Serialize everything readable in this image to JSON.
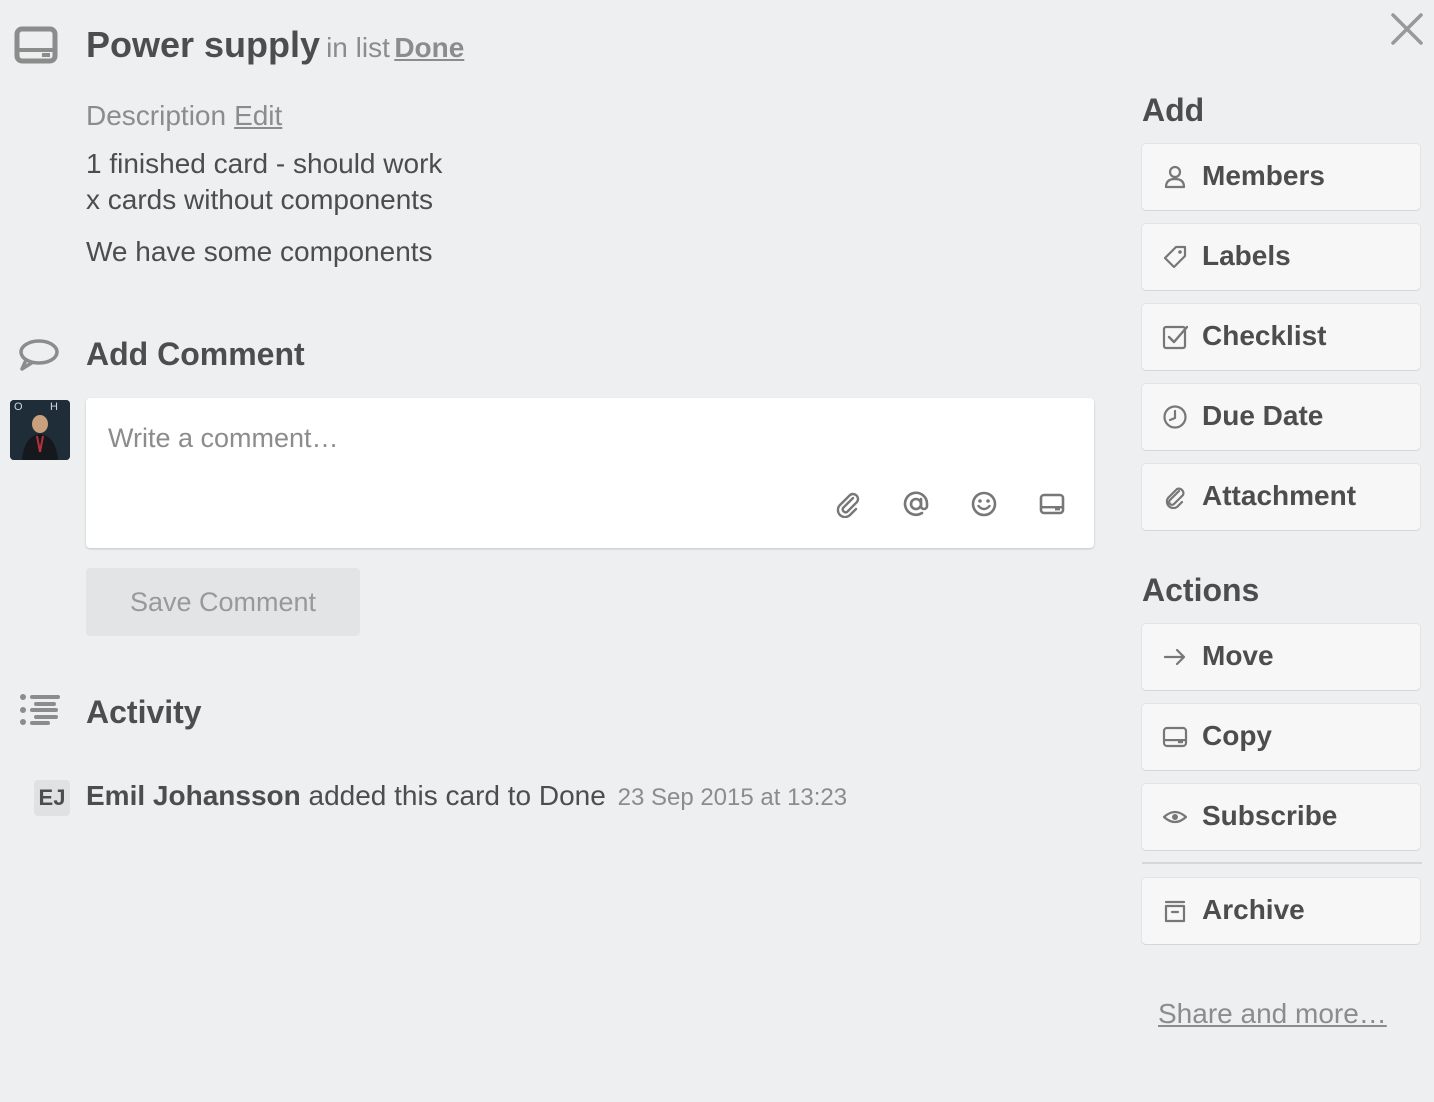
{
  "card": {
    "title": "Power supply",
    "in_list_text": "in list",
    "list_name": "Done"
  },
  "description": {
    "label": "Description",
    "edit_label": "Edit",
    "lines": [
      "1 finished card - should work",
      "x cards without components",
      "We have some components"
    ]
  },
  "comment": {
    "section_title": "Add Comment",
    "placeholder": "Write a comment…",
    "save_label": "Save Comment",
    "icons": [
      "paperclip-icon",
      "mention-icon",
      "emoji-icon",
      "card-icon"
    ]
  },
  "activity": {
    "section_title": "Activity",
    "entries": [
      {
        "initials": "EJ",
        "member": "Emil Johansson",
        "action": "added this card to Done",
        "date": "23 Sep 2015 at 13:23"
      }
    ]
  },
  "sidebar": {
    "add_title": "Add",
    "add_items": [
      {
        "label": "Members",
        "icon": "person-icon"
      },
      {
        "label": "Labels",
        "icon": "tag-icon"
      },
      {
        "label": "Checklist",
        "icon": "checkbox-icon"
      },
      {
        "label": "Due Date",
        "icon": "clock-icon"
      },
      {
        "label": "Attachment",
        "icon": "paperclip-icon"
      }
    ],
    "actions_title": "Actions",
    "action_items": [
      {
        "label": "Move",
        "icon": "arrow-right-icon"
      },
      {
        "label": "Copy",
        "icon": "card-icon"
      },
      {
        "label": "Subscribe",
        "icon": "eye-icon"
      },
      {
        "label": "Archive",
        "icon": "archive-icon"
      }
    ],
    "share_label": "Share and more…"
  },
  "colors": {
    "background": "#edeff0",
    "text": "#4d4d4d",
    "muted": "#8c8c8c",
    "button": "#f7f7f7"
  }
}
